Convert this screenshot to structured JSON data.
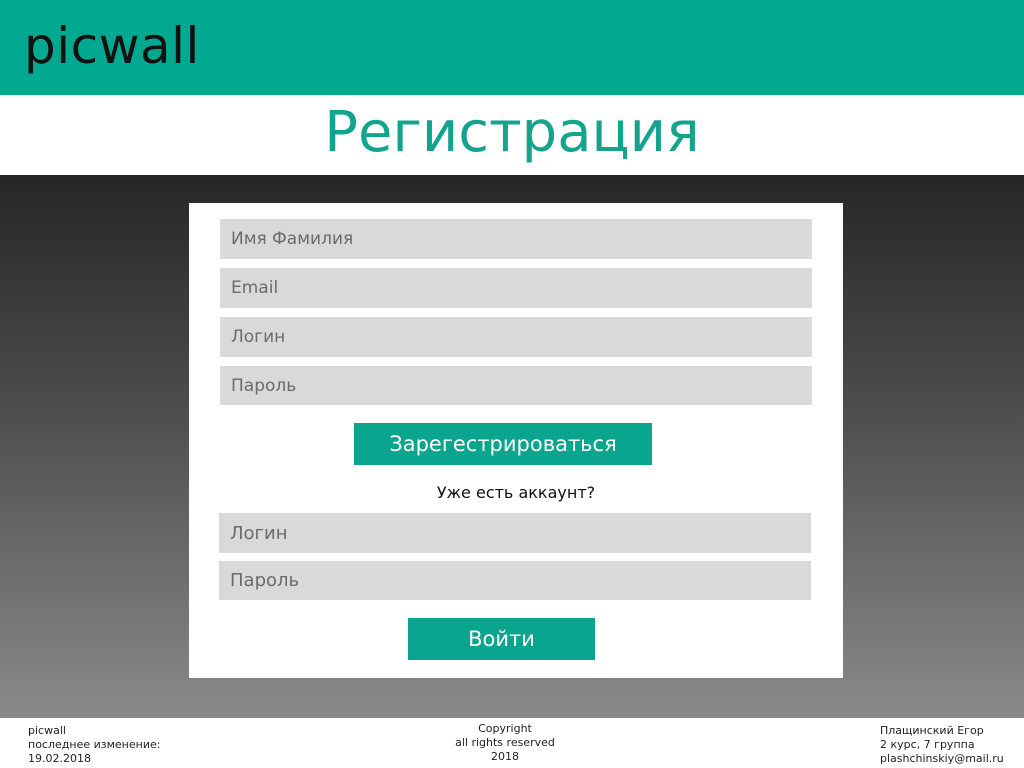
{
  "header": {
    "logo": "picwall",
    "bg_color": "#00a98f"
  },
  "page": {
    "title": "Регистрация",
    "title_color": "#14a48d"
  },
  "registration": {
    "name_placeholder": "Имя Фамилия",
    "email_placeholder": "Email",
    "login_placeholder": "Логин",
    "password_placeholder": "Пароль",
    "submit_label": "Зарегестрироваться"
  },
  "login": {
    "prompt": "Уже есть аккаунт?",
    "login_placeholder": "Логин",
    "password_placeholder": "Пароль",
    "submit_label": "Войти"
  },
  "footer": {
    "left": [
      "picwall",
      "последнее изменение:",
      "19.02.2018"
    ],
    "center": [
      "Copyright",
      "all rights reserved",
      "2018"
    ],
    "right": [
      "Плащинский Егор",
      "2 курс, 7 группа",
      "plashchinskiy@mail.ru"
    ]
  },
  "colors": {
    "accent": "#0aa58e",
    "field_bg": "#d9d9d9"
  }
}
